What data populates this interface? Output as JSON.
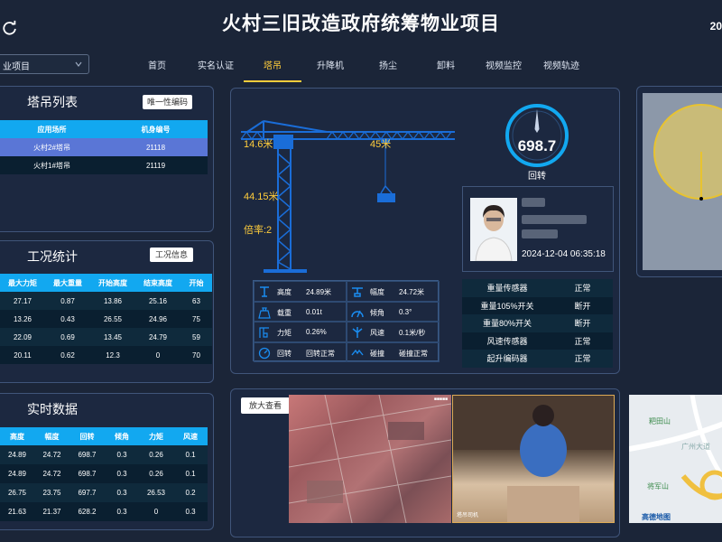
{
  "header": {
    "title": "火村三旧改造政府统筹物业项目",
    "date_partial": "20",
    "project_select": "业项目"
  },
  "nav": {
    "items": [
      {
        "label": "首页"
      },
      {
        "label": "实名认证"
      },
      {
        "label": "塔吊"
      },
      {
        "label": "升降机"
      },
      {
        "label": "扬尘"
      },
      {
        "label": "卸料"
      },
      {
        "label": "视频监控"
      },
      {
        "label": "视频轨迹"
      }
    ],
    "active": "塔吊"
  },
  "crane_list": {
    "title": "塔吊列表",
    "button": "唯一性编码",
    "columns": [
      "应用场所",
      "机身编号"
    ],
    "rows": [
      [
        "火村2#塔吊",
        "21118"
      ],
      [
        "火村1#塔吊",
        "21119"
      ]
    ]
  },
  "work_stats": {
    "title": "工况统计",
    "button": "工况信息",
    "columns": [
      "最大力矩",
      "最大重量",
      "开始高度",
      "结束高度",
      "开始"
    ],
    "rows": [
      [
        "27.17",
        "0.87",
        "13.86",
        "25.16",
        "63"
      ],
      [
        "13.26",
        "0.43",
        "26.55",
        "24.96",
        "75"
      ],
      [
        "22.09",
        "0.69",
        "13.45",
        "24.79",
        "59"
      ],
      [
        "20.11",
        "0.62",
        "12.3",
        "0",
        "70"
      ]
    ]
  },
  "realtime": {
    "title": "实时数据",
    "columns": [
      "高度",
      "幅度",
      "回转",
      "倾角",
      "力矩",
      "风速"
    ],
    "rows": [
      [
        "24.89",
        "24.72",
        "698.7",
        "0.3",
        "0.26",
        "0.1"
      ],
      [
        "24.89",
        "24.72",
        "698.7",
        "0.3",
        "0.26",
        "0.1"
      ],
      [
        "26.75",
        "23.75",
        "697.7",
        "0.3",
        "26.53",
        "0.2"
      ],
      [
        "21.63",
        "21.37",
        "628.2",
        "0.3",
        "0",
        "0.3"
      ]
    ]
  },
  "crane": {
    "left_len": "14.6米",
    "right_len": "45米",
    "height": "44.15米",
    "ratio": "倍率:2",
    "gauge_value": "698.7",
    "gauge_label": "回转"
  },
  "info": [
    {
      "icon": "height-icon",
      "label": "高度",
      "value": "24.89米"
    },
    {
      "icon": "amplitude-icon",
      "label": "幅度",
      "value": "24.72米"
    },
    {
      "icon": "weight-icon",
      "label": "载重",
      "value": "0.01t"
    },
    {
      "icon": "tilt-icon",
      "label": "倾角",
      "value": "0.3°"
    },
    {
      "icon": "torque-icon",
      "label": "力矩",
      "value": "0.26%"
    },
    {
      "icon": "wind-icon",
      "label": "风速",
      "value": "0.1米/秒"
    },
    {
      "icon": "rotation-icon",
      "label": "回转",
      "value": "回转正常"
    },
    {
      "icon": "collision-icon",
      "label": "碰撞",
      "value": "碰撞正常"
    }
  ],
  "operator": {
    "time": "2024-12-04 06:35:18"
  },
  "sensors": [
    [
      "重量传感器",
      "正常"
    ],
    [
      "重量105%开关",
      "断开"
    ],
    [
      "重量80%开关",
      "断开"
    ],
    [
      "风速传感器",
      "正常"
    ],
    [
      "起升编码器",
      "正常"
    ]
  ],
  "video": {
    "button": "放大查看",
    "cam2_label": "塔吊司机"
  },
  "map": {
    "place1": "粑田山",
    "place2": "将军山",
    "road": "广州大道",
    "brand": "高德地图"
  },
  "colors": {
    "accent": "#12a8f0",
    "active_nav": "#ffcd3c",
    "crane": "#1a6dd8",
    "selected_row": "#5a76d6"
  }
}
